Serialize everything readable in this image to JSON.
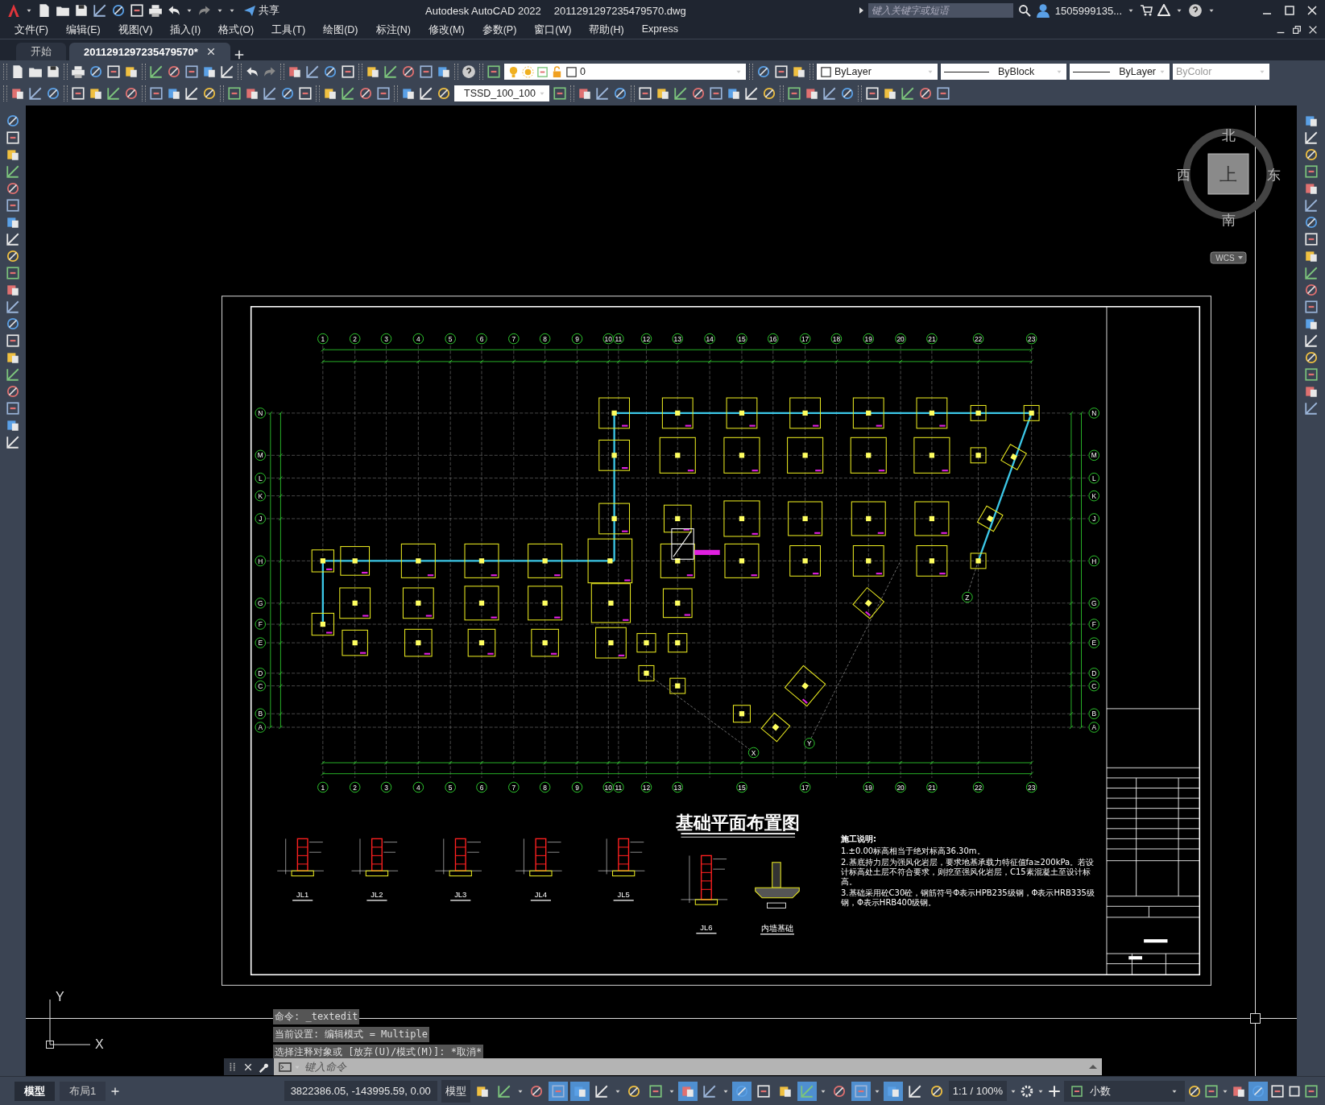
{
  "title_bar": {
    "share": "共享",
    "app_title": "Autodesk AutoCAD 2022",
    "file_name": "2011291297235479570.dwg",
    "search": {
      "placeholder": "键入关键字或短语"
    },
    "user": "1505999135..."
  },
  "menu": [
    "文件(F)",
    "编辑(E)",
    "视图(V)",
    "插入(I)",
    "格式(O)",
    "工具(T)",
    "绘图(D)",
    "标注(N)",
    "修改(M)",
    "参数(P)",
    "窗口(W)",
    "帮助(H)",
    "Express"
  ],
  "tabs": [
    {
      "label": "开始",
      "selected": false
    },
    {
      "label": "2011291297235479570*",
      "selected": true
    }
  ],
  "toolbar": {
    "layer": "0",
    "color_control": "ByLayer",
    "linetype": "ByBlock",
    "lineweight": "ByLayer",
    "plot_style": "ByColor",
    "dim_style": "TSSD_100_100"
  },
  "viewcube": {
    "north": "北",
    "west": "西",
    "east": "东",
    "south": "南",
    "face": "上",
    "ucs": "WCS"
  },
  "drawing": {
    "top_axes": [
      "1",
      "2",
      "3",
      "4",
      "5",
      "6",
      "7",
      "8",
      "9",
      "10",
      "11",
      "12",
      "13",
      "14",
      "15",
      "16",
      "17",
      "18",
      "19",
      "20",
      "21",
      "22",
      "23"
    ],
    "bottom_axes": [
      "1",
      "2",
      "3",
      "4",
      "5",
      "6",
      "7",
      "8",
      "9",
      "10",
      "11",
      "12",
      "13",
      "15",
      "17",
      "19",
      "20",
      "21",
      "22",
      "23"
    ],
    "left_axes": [
      "N",
      "M",
      "L",
      "K",
      "J",
      "H",
      "G",
      "F",
      "E",
      "D",
      "C",
      "B",
      "A"
    ],
    "right_axes": [
      "N",
      "M",
      "L",
      "K",
      "J",
      "H",
      "G",
      "F",
      "E",
      "D",
      "C",
      "B",
      "A"
    ],
    "diagonal_axes": [
      "X",
      "Y",
      "Z"
    ],
    "title": "基础平面布置图",
    "details": [
      "JL1",
      "JL2",
      "JL3",
      "JL4",
      "JL5"
    ],
    "section_details": [
      "JL6",
      "内墙基础"
    ],
    "notes_title": "施工说明:",
    "notes": [
      "1.±0.00标高相当于绝对标高36.30m。",
      "2.基底持力层为强风化岩层，要求地基承载力特征值fa≥200kPa。若设计标高处土层不符合要求，则挖至强风化岩层，C15素混凝土至设计标高。",
      "3.基础采用砼C30砼，钢筋符号Φ表示HPB235级钢，Φ表示HRB335级钢，Φ表示HRB400级钢。"
    ]
  },
  "ucs_icon": {
    "x": "X",
    "y": "Y"
  },
  "command": {
    "history": [
      "命令: _textedit",
      "当前设置: 编辑模式 = Multiple",
      "选择注释对象或 [放弃(U)/模式(M)]: *取消*"
    ],
    "placeholder": "键入命令"
  },
  "layout_tabs": [
    {
      "label": "模型",
      "selected": true
    },
    {
      "label": "布局1",
      "selected": false
    }
  ],
  "status_bar": {
    "coordinates": "3822386.05, -143995.59, 0.00",
    "space": "模型",
    "scale": "1:1 / 100%",
    "units": "小数",
    "toggles": [
      {
        "on": false
      },
      {
        "on": false
      },
      {
        "on": false
      },
      {
        "on": true
      },
      {
        "on": true
      },
      {
        "on": false
      },
      {
        "on": false
      },
      {
        "on": false
      },
      {
        "on": true
      },
      {
        "on": false
      },
      {
        "on": true
      },
      {
        "on": false
      },
      {
        "on": false
      },
      {
        "on": true
      },
      {
        "on": false
      },
      {
        "on": true
      },
      {
        "on": true
      },
      {
        "on": false
      },
      {
        "on": false
      }
    ],
    "isolate": {
      "on": true
    }
  }
}
